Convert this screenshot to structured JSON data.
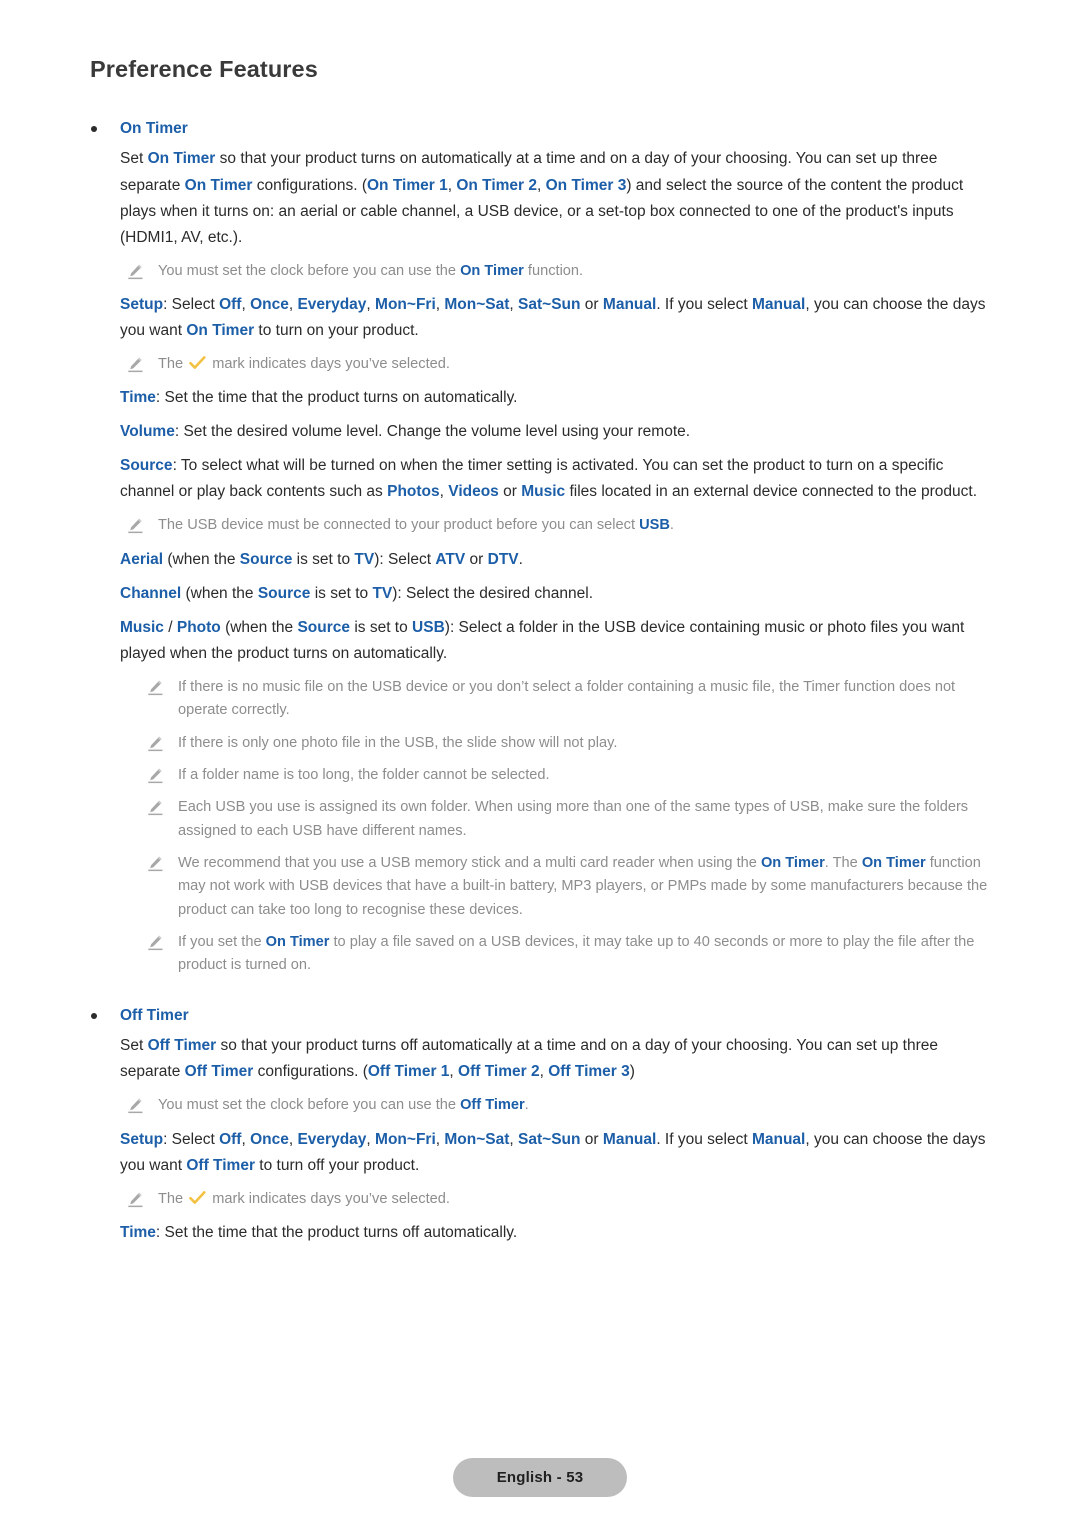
{
  "page": {
    "title": "Preference Features",
    "footer_badge": "English - 53",
    "colors": {
      "keyword_blue": "#1c5ea8",
      "body_text": "#2b2b2b",
      "note_text": "#8d8d8d",
      "check_gold": "#f3c243",
      "pencil_gray": "#9a9a9a",
      "badge_bg": "#bdbdbd"
    }
  },
  "sections": [
    {
      "id": "on-timer",
      "heading": "On Timer",
      "paragraph_1": {
        "p1": "Set ",
        "k1": "On Timer",
        "p2": " so that your product turns on automatically at a time and on a day of your choosing. You can set up three separate ",
        "k2": "On Timer",
        "p3": " configurations. (",
        "k3": "On Timer 1",
        "p4": ", ",
        "k4": "On Timer 2",
        "p5": ", ",
        "k5": "On Timer 3",
        "p6": ") and select the source of the content the product plays when it turns on: an aerial or cable channel, a USB device, or a set-top box connected to one of the product's inputs (HDMI1, AV, etc.)."
      },
      "note_clock": {
        "p1": "You must set the clock before you can use the ",
        "k1": "On Timer",
        "p2": " function."
      },
      "setup": {
        "label": "Setup",
        "p1": ": Select ",
        "opt1": "Off",
        "s1": ", ",
        "opt2": "Once",
        "s2": ", ",
        "opt3": "Everyday",
        "s3": ", ",
        "opt4": "Mon~Fri",
        "s4": ", ",
        "opt5": "Mon~Sat",
        "s5": ", ",
        "opt6": "Sat~Sun",
        "s6": " or ",
        "opt7": "Manual",
        "p2": ". If you select ",
        "opt8": "Manual",
        "p3": ", you can choose the days you want ",
        "k1": "On Timer",
        "p4": " to turn on your product."
      },
      "note_check": {
        "p1": "The ",
        "p2": " mark indicates days you’ve selected."
      },
      "time": {
        "label": "Time",
        "text": ": Set the time that the product turns on automatically."
      },
      "volume": {
        "label": "Volume",
        "text": ": Set the desired volume level. Change the volume level using your remote."
      },
      "source": {
        "label": "Source",
        "p1": ": To select what will be turned on when the timer setting is activated. You can set the product to turn on a specific channel or play back contents such as ",
        "k1": "Photos",
        "p2": ", ",
        "k2": "Videos",
        "p3": " or ",
        "k3": "Music",
        "p4": " files located in an external device connected to the product."
      },
      "note_usb": {
        "p1": "The USB device must be connected to your product before you can select ",
        "k1": "USB",
        "p2": "."
      },
      "aerial": {
        "label": "Aerial",
        "p1": " (when the ",
        "k1": "Source",
        "p2": " is set to ",
        "k2": "TV",
        "p3": "): Select ",
        "k3": "ATV",
        "p4": " or ",
        "k4": "DTV",
        "p5": "."
      },
      "channel": {
        "label": "Channel",
        "p1": " (when the ",
        "k1": "Source",
        "p2": " is set to ",
        "k2": "TV",
        "p3": "): Select the desired channel."
      },
      "music_photo": {
        "label1": "Music",
        "sep": " / ",
        "label2": "Photo",
        "p1": " (when the ",
        "k1": "Source",
        "p2": " is set to ",
        "k2": "USB",
        "p3": "): Select a folder in the USB device containing music or photo files you want played when the product turns on automatically."
      },
      "sub_notes": [
        {
          "text": "If there is no music file on the USB device or you don’t select a folder containing a music file, the Timer function does not operate correctly."
        },
        {
          "text": "If there is only one photo file in the USB, the slide show will not play."
        },
        {
          "text": "If a folder name is too long, the folder cannot be selected."
        },
        {
          "text": "Each USB you use is assigned its own folder. When using more than one of the same types of USB, make sure the folders assigned to each USB have different names."
        }
      ],
      "note_recommend": {
        "p1": "We recommend that you use a USB memory stick and a multi card reader when using the ",
        "k1": "On Timer",
        "p2": ". The ",
        "k2": "On Timer",
        "p3": " function may not work with USB devices that have a built-in battery, MP3 players, or PMPs made by some manufacturers because the product can take too long to recognise these devices."
      },
      "note_delay": {
        "p1": "If you set the ",
        "k1": "On Timer",
        "p2": " to play a file saved on a USB devices, it may take up to 40 seconds or more to play the file after the product is turned on."
      }
    },
    {
      "id": "off-timer",
      "heading": "Off Timer",
      "paragraph_1": {
        "p1": "Set ",
        "k1": "Off Timer",
        "p2": " so that your product turns off automatically at a time and on a day of your choosing. You can set up three separate ",
        "k2": "Off Timer",
        "p3": " configurations. (",
        "k3": "Off Timer 1",
        "p4": ", ",
        "k4": "Off Timer 2",
        "p5": ", ",
        "k5": "Off Timer 3",
        "p6": ")"
      },
      "note_clock": {
        "p1": "You must set the clock before you can use the ",
        "k1": "Off Timer",
        "p2": "."
      },
      "setup": {
        "label": "Setup",
        "p1": ": Select ",
        "opt1": "Off",
        "s1": ", ",
        "opt2": "Once",
        "s2": ", ",
        "opt3": "Everyday",
        "s3": ", ",
        "opt4": "Mon~Fri",
        "s4": ", ",
        "opt5": "Mon~Sat",
        "s5": ", ",
        "opt6": "Sat~Sun",
        "s6": " or ",
        "opt7": "Manual",
        "p2": ". If you select ",
        "opt8": "Manual",
        "p3": ", you can choose the days you want ",
        "k1": "Off Timer",
        "p4": " to turn off your product."
      },
      "note_check": {
        "p1": "The ",
        "p2": " mark indicates days you’ve selected."
      },
      "time": {
        "label": "Time",
        "text": ": Set the time that the product turns off automatically."
      }
    }
  ]
}
